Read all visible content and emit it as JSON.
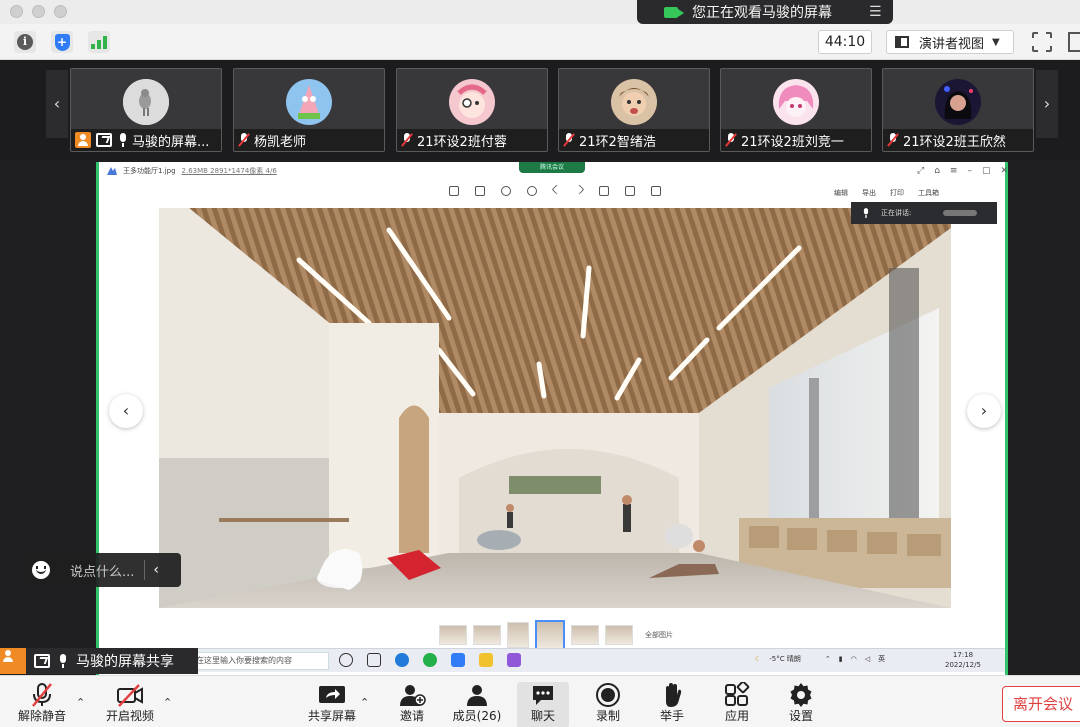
{
  "banner": {
    "viewing_text": "您正在观看马骏的屏幕"
  },
  "toolbar": {
    "timer": "44:10",
    "view_mode": "演讲者视图"
  },
  "participants": [
    {
      "name": "马骏的屏幕...",
      "avatar_color": "#d8d8d8"
    },
    {
      "name": "杨凯老师",
      "avatar_color": "#8fc4ef"
    },
    {
      "name": "21环设2班付蓉",
      "avatar_color": "#f5c7cf"
    },
    {
      "name": "21环2智绪浩",
      "avatar_color": "#c9a07a"
    },
    {
      "name": "21环设2班刘竞一",
      "avatar_color": "#f4b5d8"
    },
    {
      "name": "21环设2班王欣然",
      "avatar_color": "#2b1f44"
    }
  ],
  "shared_screen": {
    "file_name": "王多功能厅1.jpg",
    "file_meta": "2.63MB  2891*1474像素  4/6",
    "share_tag": "腾讯会议",
    "actions": [
      "编辑",
      "导出",
      "打印",
      "工具箱"
    ],
    "speaking_label": "正在讲话:",
    "all_images_label": "全部图片",
    "taskbar_search": "在这里输入你要搜索的内容",
    "weather": "-5°C  晴朗",
    "ime": "英",
    "clock_time": "17:18",
    "clock_date": "2022/12/5"
  },
  "chat": {
    "placeholder": "说点什么..."
  },
  "sharing_label": {
    "name": "马骏的屏幕共享"
  },
  "controls": {
    "unmute": "解除静音",
    "start_video": "开启视频",
    "share_screen": "共享屏幕",
    "invite": "邀请",
    "members": "成员(26)",
    "chat": "聊天",
    "record": "录制",
    "raise_hand": "举手",
    "apps": "应用",
    "settings": "设置",
    "leave": "离开会议"
  },
  "colors": {
    "accent_green": "#31c46c",
    "leave_red": "#e0403f",
    "host_orange": "#f08a24"
  }
}
